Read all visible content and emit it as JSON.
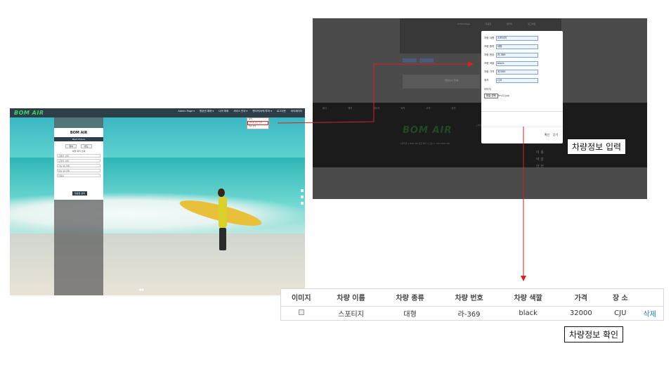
{
  "landing": {
    "logo": "BOM AIR",
    "menu": [
      "Admin Page ▾",
      "항공권 예매 ▾",
      "나의 예매",
      "서비스 안내 ▾",
      "렌터카/숙박/투어 ▾",
      "로그아웃",
      "마이페이지"
    ],
    "dropdown_items": [
      "숙박",
      "렌터카 정보 입력",
      "게시 정보"
    ],
    "form": {
      "title": "BOM AIR",
      "bar": "Best Choice",
      "trip_buttons": [
        "왕복",
        "편도"
      ],
      "subtitle": "여행 목적 선택",
      "fields": [
        "출발지 선택",
        "도착지 선택",
        "가는 날 선택",
        "오는 날 선택",
        "인원수"
      ],
      "submit": "항공권 검색"
    }
  },
  "modal_screen": {
    "top_links": [
      "Admin Page",
      "항공권",
      "렌터카",
      "로그아웃"
    ],
    "middle_text": "렌터카 목록",
    "footer_nav": [
      "회사",
      "예약",
      "렌터카",
      "숙박",
      "고객",
      "공지"
    ],
    "footer_logo": "BOM AIR",
    "footer_info": "서울특별시 BOM AIR 항공 예약 시스템 © 2019 BOM AIR",
    "footer_contact": "고객센터 1588-0000",
    "footer_korean": [
      "이 용",
      "약 관",
      "안 전"
    ],
    "modal": {
      "fields": [
        {
          "label": "차량 이름",
          "value": "스포티지"
        },
        {
          "label": "차량 종류",
          "value": "대형"
        },
        {
          "label": "차량 번호",
          "value": "라-369"
        },
        {
          "label": "차량 색깔",
          "value": "black"
        },
        {
          "label": "차량 가격",
          "value": "32000"
        },
        {
          "label": "위치",
          "value": "CJU"
        }
      ],
      "image_label": "이미지",
      "file_button": "파일 선택",
      "file_status": "fm(1).jpg",
      "confirm": "확인",
      "close": "닫기"
    }
  },
  "table": {
    "headers": [
      "이미지",
      "차량 이름",
      "차량 종류",
      "차량 번호",
      "차량 색깔",
      "가격",
      "장 소",
      ""
    ],
    "row": {
      "name": "스포티지",
      "type": "대형",
      "number": "라-369",
      "color": "black",
      "price": "32000",
      "place": "CJU",
      "delete": "삭제"
    }
  },
  "callouts": {
    "input": "차량정보  입력",
    "confirm": "차량정보  확인"
  },
  "colors": {
    "nav": "#2e3e49",
    "logo_green": "#3fd26b",
    "arrow_red": "#d62222",
    "delete_link": "#2a7bbd"
  }
}
